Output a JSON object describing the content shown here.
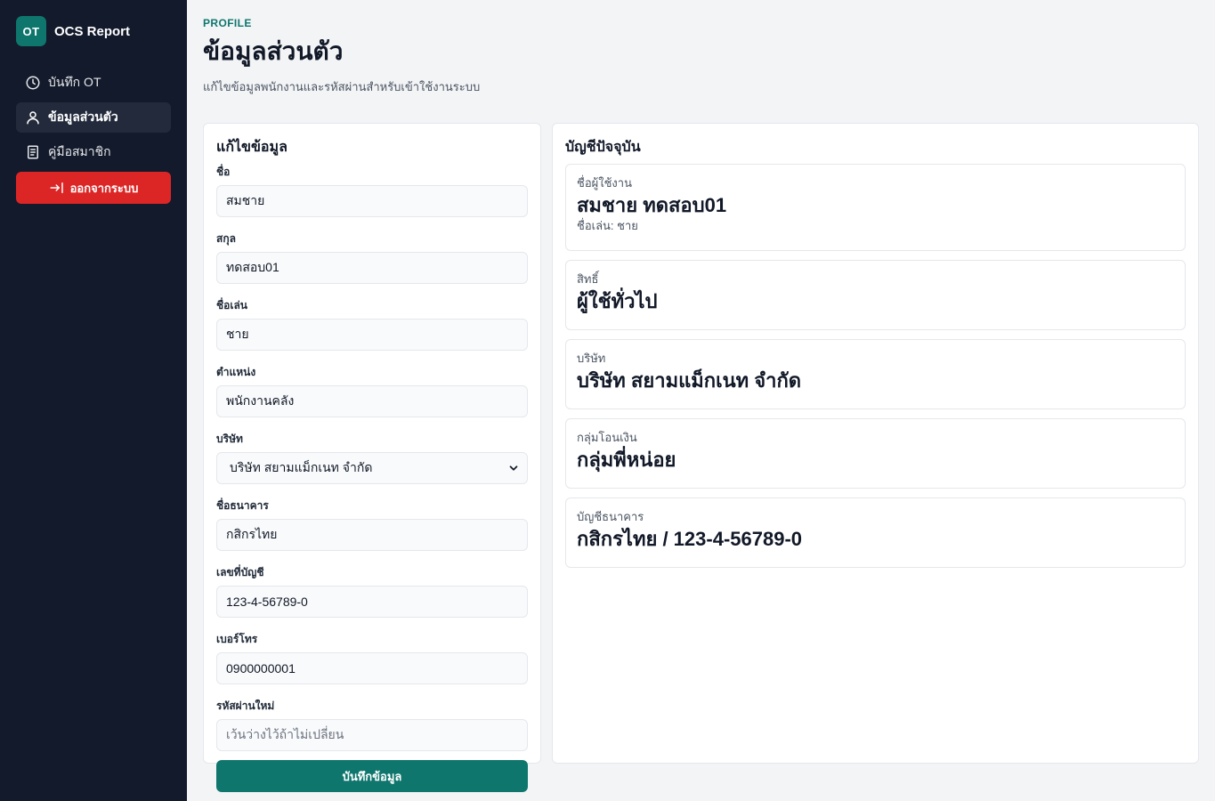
{
  "brand": {
    "logo_text": "OT",
    "name": "OCS Report",
    "accent": "#0f766e"
  },
  "sidebar": {
    "items": [
      {
        "label": "บันทึก OT",
        "icon": "clock-icon",
        "active": false
      },
      {
        "label": "ข้อมูลส่วนตัว",
        "icon": "user-icon",
        "active": true
      },
      {
        "label": "คู่มือสมาชิก",
        "icon": "book-icon",
        "active": false
      }
    ],
    "logout_label": "ออกจากระบบ",
    "logout_icon": "logout-icon",
    "logout_color": "#dc2626"
  },
  "header": {
    "eyebrow": "PROFILE",
    "title": "ข้อมูลส่วนตัว",
    "subtitle": "แก้ไขข้อมูลพนักงานและรหัสผ่านสำหรับเข้าใช้งานระบบ"
  },
  "form": {
    "title": "แก้ไขข้อมูล",
    "fields": {
      "first_name": {
        "label": "ชื่อ",
        "value": "สมชาย"
      },
      "last_name": {
        "label": "สกุล",
        "value": "ทดสอบ01"
      },
      "nickname": {
        "label": "ชื่อเล่น",
        "value": "ชาย"
      },
      "position": {
        "label": "ตำแหน่ง",
        "value": "พนักงานคลัง"
      },
      "company": {
        "label": "บริษัท",
        "value": "บริษัท สยามแม็กเนท จำกัด"
      },
      "bank_name": {
        "label": "ชื่อธนาคาร",
        "value": "กสิกรไทย"
      },
      "account_no": {
        "label": "เลขที่บัญชี",
        "value": "123-4-56789-0"
      },
      "phone": {
        "label": "เบอร์โทร",
        "value": "0900000001"
      },
      "new_password": {
        "label": "รหัสผ่านใหม่",
        "value": "",
        "placeholder": "เว้นว่างไว้ถ้าไม่เปลี่ยน"
      }
    },
    "save_label": "บันทึกข้อมูล"
  },
  "summary": {
    "title": "บัญชีปัจจุบัน",
    "username": {
      "label": "ชื่อผู้ใช้งาน",
      "value": "สมชาย ทดสอบ01",
      "sub": "ชื่อเล่น: ชาย"
    },
    "role": {
      "label": "สิทธิ์",
      "value": "ผู้ใช้ทั่วไป"
    },
    "company": {
      "label": "บริษัท",
      "value": "บริษัท สยามแม็กเนท จำกัด"
    },
    "transfer_group": {
      "label": "กลุ่มโอนเงิน",
      "value": "กลุ่มพี่หน่อย"
    },
    "bank_account": {
      "label": "บัญชีธนาคาร",
      "value": "กสิกรไทย / 123-4-56789-0"
    }
  }
}
